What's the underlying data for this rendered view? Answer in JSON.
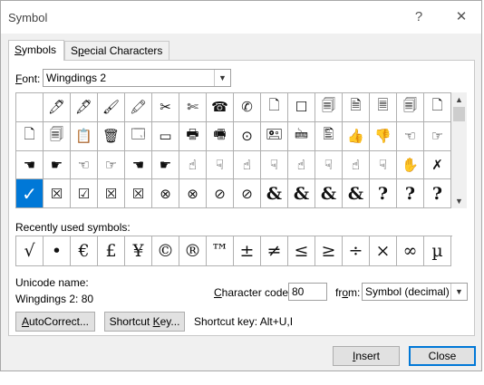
{
  "window": {
    "title": "Symbol",
    "help_label": "?",
    "close_label": "✕"
  },
  "tabs": [
    {
      "label": "Symbols",
      "underline": "S",
      "rest": "ymbols"
    },
    {
      "label": "Special Characters",
      "pre": "S",
      "underline": "p",
      "rest": "ecial Characters"
    }
  ],
  "font": {
    "label_underline": "F",
    "label_rest": "ont:",
    "value": "Wingdings 2"
  },
  "symbol_grid": {
    "rows": [
      [
        "",
        "🖊",
        "🖋",
        "🖌",
        "🖍",
        "✂",
        "✄",
        "☎",
        "✆",
        "🗋",
        "☐",
        "🗐",
        "🗎",
        "🗏",
        "🗐",
        "🗋"
      ],
      [
        "🗋",
        "🗐",
        "📋",
        "🗑",
        "🗔",
        "▭",
        "🖶",
        "🖷",
        "⊙",
        "🖭",
        "🖮",
        "🖺",
        "👍",
        "👎",
        "☜",
        "☞"
      ],
      [
        "☚",
        "☛",
        "☜",
        "☞",
        "☚",
        "☛",
        "☝",
        "☟",
        "☝",
        "☟",
        "☝",
        "☟",
        "☝",
        "☟",
        "✋",
        "✗"
      ],
      [
        "✓",
        "☒",
        "☑",
        "☒",
        "☒",
        "⊗",
        "⊗",
        "⊘",
        "⊘",
        "&",
        "&",
        "&",
        "&",
        "?",
        "?",
        "?"
      ]
    ],
    "selected": "✓"
  },
  "recent": {
    "label": "Recently used symbols:",
    "symbols": [
      "√",
      "•",
      "€",
      "£",
      "¥",
      "©",
      "®",
      "™",
      "±",
      "≠",
      "≤",
      "≥",
      "÷",
      "×",
      "∞",
      "µ"
    ]
  },
  "unicode_name": {
    "label": "Unicode name:",
    "value": "Wingdings 2: 80"
  },
  "character_code": {
    "label_underline": "C",
    "label_rest": "haracter code:",
    "value": "80",
    "from_label_pre": "fr",
    "from_label_underline": "o",
    "from_label_rest": "m:",
    "from_value": "Symbol (decimal)"
  },
  "buttons": {
    "autocorrect_underline": "A",
    "autocorrect_rest": "utoCorrect...",
    "shortcut_pre": "Shortcut ",
    "shortcut_underline": "K",
    "shortcut_rest": "ey...",
    "shortcut_key_text": "Shortcut key: Alt+U,I",
    "insert_underline": "I",
    "insert_rest": "nsert",
    "close": "Close"
  }
}
